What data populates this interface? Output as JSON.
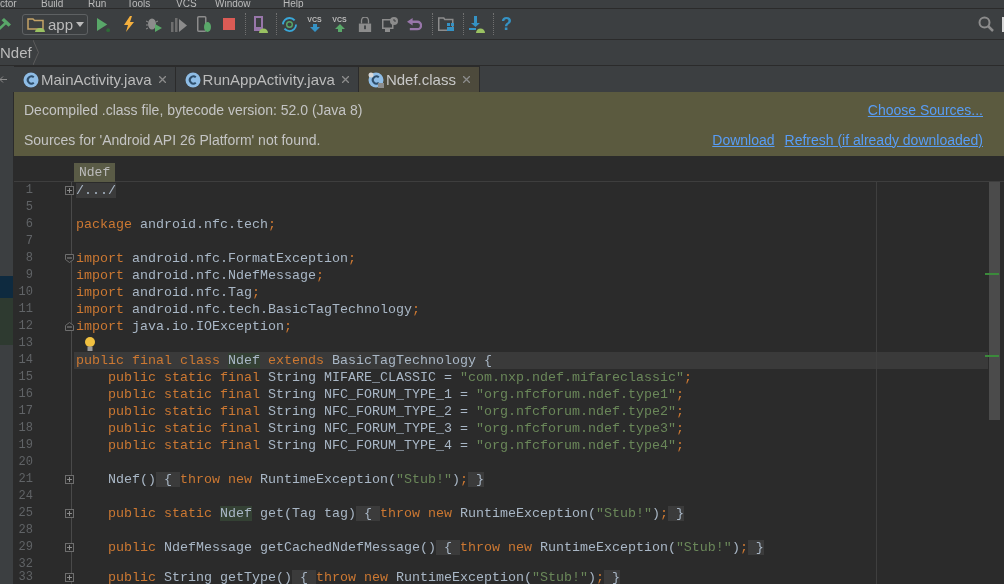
{
  "menu": [
    "ctor",
    "Build",
    "Run",
    "Tools",
    "VCS",
    "Window",
    "Help"
  ],
  "toolbar": {
    "run_configuration": "app",
    "vcs_update_label": "VCS",
    "vcs_commit_label": "VCS",
    "help_label": "?"
  },
  "breadcrumb": [
    "Ndef"
  ],
  "tabs": [
    {
      "label": "MainActivity.java",
      "kind": "java",
      "selected": false
    },
    {
      "label": "RunAppActivity.java",
      "kind": "java",
      "selected": false
    },
    {
      "label": "Ndef.class",
      "kind": "class",
      "selected": true
    }
  ],
  "banner": {
    "message": "Decompiled .class file, bytecode version: 52.0 (Java 8)",
    "message_link": "Choose Sources...",
    "notice": "Sources for 'Android API 26 Platform' not found.",
    "notice_links": [
      "Download",
      "Refresh (if already downloaded)"
    ]
  },
  "editor": {
    "sticky_header": "Ndef",
    "lines": [
      {
        "number": "1",
        "fold": {
          "kind": "expand"
        },
        "current": false,
        "tokens": [
          {
            "text": "/.../",
            "kind": "fold"
          }
        ]
      },
      {
        "number": "5",
        "current": false
      },
      {
        "number": "6",
        "current": false,
        "tokens": [
          {
            "text": "package",
            "kind": "keyword"
          },
          {
            "text": " android.nfc.tech",
            "kind": "plain"
          },
          {
            "text": ";",
            "kind": "punct"
          }
        ]
      },
      {
        "number": "7",
        "current": false
      },
      {
        "number": "8",
        "fold": {
          "kind": "collapse_start"
        },
        "current": false,
        "tokens": [
          {
            "text": "import",
            "kind": "keyword"
          },
          {
            "text": " android.nfc.FormatException",
            "kind": "plain"
          },
          {
            "text": ";",
            "kind": "punct"
          }
        ]
      },
      {
        "number": "9",
        "current": false,
        "tokens": [
          {
            "text": "import",
            "kind": "keyword"
          },
          {
            "text": " android.nfc.NdefMessage",
            "kind": "plain"
          },
          {
            "text": ";",
            "kind": "punct"
          }
        ]
      },
      {
        "number": "10",
        "current": false,
        "tokens": [
          {
            "text": "import",
            "kind": "keyword"
          },
          {
            "text": " android.nfc.Tag",
            "kind": "plain"
          },
          {
            "text": ";",
            "kind": "punct"
          }
        ]
      },
      {
        "number": "11",
        "current": false,
        "tokens": [
          {
            "text": "import",
            "kind": "keyword"
          },
          {
            "text": " android.nfc.tech.BasicTagTechnology",
            "kind": "plain"
          },
          {
            "text": ";",
            "kind": "punct"
          }
        ]
      },
      {
        "number": "12",
        "fold": {
          "kind": "collapse_end"
        },
        "current": false,
        "tokens": [
          {
            "text": "import",
            "kind": "keyword"
          },
          {
            "text": " java.io.IOException",
            "kind": "plain"
          },
          {
            "text": ";",
            "kind": "punct"
          }
        ]
      },
      {
        "number": "13",
        "current": false,
        "bulb": true
      },
      {
        "number": "14",
        "current": true,
        "tokens": [
          {
            "text": "public final class ",
            "kind": "keyword"
          },
          {
            "text": "Ndef",
            "kind": "usage"
          },
          {
            "text": " extends",
            "kind": "keyword"
          },
          {
            "text": " BasicTagTechnology {",
            "kind": "plain"
          }
        ]
      },
      {
        "number": "15",
        "current": false,
        "tokens": [
          {
            "text": "    public static final",
            "kind": "keyword"
          },
          {
            "text": " String MIFARE_CLASSIC = ",
            "kind": "plain"
          },
          {
            "text": "\"com.nxp.ndef.mifareclassic\"",
            "kind": "string"
          },
          {
            "text": ";",
            "kind": "punct"
          }
        ]
      },
      {
        "number": "16",
        "current": false,
        "tokens": [
          {
            "text": "    public static final",
            "kind": "keyword"
          },
          {
            "text": " String NFC_FORUM_TYPE_1 = ",
            "kind": "plain"
          },
          {
            "text": "\"org.nfcforum.ndef.type1\"",
            "kind": "string"
          },
          {
            "text": ";",
            "kind": "punct"
          }
        ]
      },
      {
        "number": "17",
        "current": false,
        "tokens": [
          {
            "text": "    public static final",
            "kind": "keyword"
          },
          {
            "text": " String NFC_FORUM_TYPE_2 = ",
            "kind": "plain"
          },
          {
            "text": "\"org.nfcforum.ndef.type2\"",
            "kind": "string"
          },
          {
            "text": ";",
            "kind": "punct"
          }
        ]
      },
      {
        "number": "18",
        "current": false,
        "tokens": [
          {
            "text": "    public static final",
            "kind": "keyword"
          },
          {
            "text": " String NFC_FORUM_TYPE_3 = ",
            "kind": "plain"
          },
          {
            "text": "\"org.nfcforum.ndef.type3\"",
            "kind": "string"
          },
          {
            "text": ";",
            "kind": "punct"
          }
        ]
      },
      {
        "number": "19",
        "current": false,
        "tokens": [
          {
            "text": "    public static final",
            "kind": "keyword"
          },
          {
            "text": " String NFC_FORUM_TYPE_4 = ",
            "kind": "plain"
          },
          {
            "text": "\"org.nfcforum.ndef.type4\"",
            "kind": "string"
          },
          {
            "text": ";",
            "kind": "punct"
          }
        ]
      },
      {
        "number": "20",
        "current": false
      },
      {
        "number": "21",
        "fold": {
          "kind": "expand"
        },
        "current": false,
        "tokens": [
          {
            "text": "    Ndef()",
            "kind": "plain"
          },
          {
            "text": " { ",
            "kind": "fold"
          },
          {
            "text": "throw new",
            "kind": "keyword"
          },
          {
            "text": " RuntimeException(",
            "kind": "plain"
          },
          {
            "text": "\"Stub!\"",
            "kind": "string"
          },
          {
            "text": ")",
            "kind": "plain"
          },
          {
            "text": ";",
            "kind": "punct"
          },
          {
            "text": " }",
            "kind": "fold"
          }
        ]
      },
      {
        "number": "24",
        "current": false
      },
      {
        "number": "25",
        "fold": {
          "kind": "expand"
        },
        "current": false,
        "tokens": [
          {
            "text": "    public static ",
            "kind": "keyword"
          },
          {
            "text": "Ndef",
            "kind": "usage"
          },
          {
            "text": " get(Tag tag)",
            "kind": "plain"
          },
          {
            "text": " { ",
            "kind": "fold"
          },
          {
            "text": "throw new",
            "kind": "keyword"
          },
          {
            "text": " RuntimeException(",
            "kind": "plain"
          },
          {
            "text": "\"Stub!\"",
            "kind": "string"
          },
          {
            "text": ")",
            "kind": "plain"
          },
          {
            "text": ";",
            "kind": "punct"
          },
          {
            "text": " }",
            "kind": "fold"
          }
        ]
      },
      {
        "number": "28",
        "current": false
      },
      {
        "number": "29",
        "fold": {
          "kind": "expand"
        },
        "current": false,
        "tokens": [
          {
            "text": "    public",
            "kind": "keyword"
          },
          {
            "text": " NdefMessage getCachedNdefMessage()",
            "kind": "plain"
          },
          {
            "text": " { ",
            "kind": "fold"
          },
          {
            "text": "throw new",
            "kind": "keyword"
          },
          {
            "text": " RuntimeException(",
            "kind": "plain"
          },
          {
            "text": "\"Stub!\"",
            "kind": "string"
          },
          {
            "text": ")",
            "kind": "plain"
          },
          {
            "text": ";",
            "kind": "punct"
          },
          {
            "text": " }",
            "kind": "fold"
          }
        ]
      },
      {
        "number": "32",
        "current": false
      },
      {
        "number": "33",
        "fold": {
          "kind": "expand"
        },
        "current": false,
        "tokens": [
          {
            "text": "    public",
            "kind": "keyword"
          },
          {
            "text": " String getType()",
            "kind": "plain"
          },
          {
            "text": " { ",
            "kind": "fold"
          },
          {
            "text": "throw new",
            "kind": "keyword"
          },
          {
            "text": " RuntimeException(",
            "kind": "plain"
          },
          {
            "text": "\"Stub!\"",
            "kind": "string"
          },
          {
            "text": ")",
            "kind": "plain"
          },
          {
            "text": ";",
            "kind": "punct"
          },
          {
            "text": " }",
            "kind": "fold"
          }
        ]
      }
    ]
  }
}
